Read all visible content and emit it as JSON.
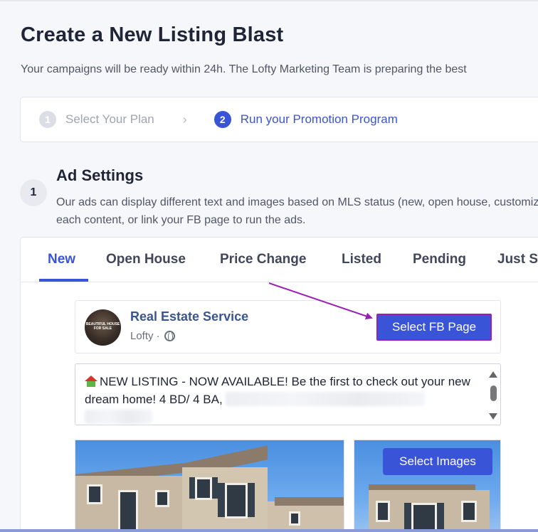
{
  "header": {
    "title": "Create a New Listing Blast",
    "subtitle": "Your campaigns will be ready within 24h. The Lofty Marketing Team is preparing the best"
  },
  "stepper": {
    "steps": [
      {
        "num": "1",
        "label": "Select Your Plan",
        "state": "inactive"
      },
      {
        "num": "2",
        "label": "Run your Promotion Program",
        "state": "active"
      }
    ],
    "chevron": "›"
  },
  "ad_settings": {
    "number": "1",
    "title": "Ad Settings",
    "description": "Our ads can display different text and images based on MLS status (new, open house, customize each content, or link your FB page to run the ads."
  },
  "tabs": [
    {
      "label": "New",
      "active": true
    },
    {
      "label": "Open House",
      "active": false
    },
    {
      "label": "Price Change",
      "active": false
    },
    {
      "label": "Listed",
      "active": false
    },
    {
      "label": "Pending",
      "active": false
    },
    {
      "label": "Just S",
      "active": false
    }
  ],
  "fb_preview": {
    "page_name": "Real Estate Service",
    "meta": "Lofty ·",
    "avatar_text": "BEAUTIFUL HOUSE FOR SALE",
    "select_page_button": "Select FB Page",
    "post_text": "NEW LISTING - NOW AVAILABLE! Be the first to check out your new dream home! 4 BD/ 4 BA,",
    "select_images_button": "Select Images"
  },
  "colors": {
    "accent": "#3a54d8",
    "annotation": "#9a1fb7",
    "fb_name": "#3b5590"
  },
  "icons": [
    "globe-icon",
    "house-emoji-icon",
    "chevron-right-icon",
    "annotation-arrow"
  ]
}
